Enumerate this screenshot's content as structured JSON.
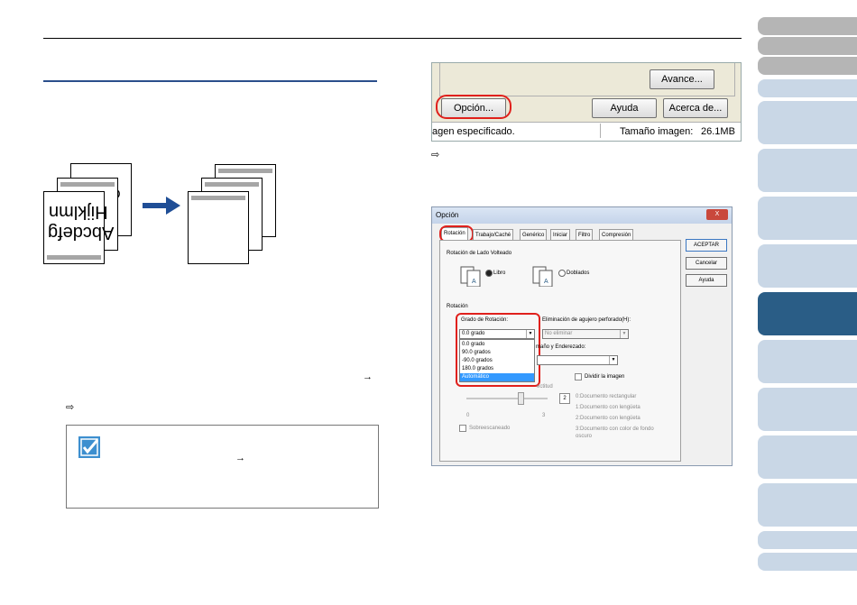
{
  "header": {
    "arrow_glyph": "⇨"
  },
  "left": {
    "see_also_arrow": "⇨",
    "ref_arrow": "→",
    "illustration": {
      "sample_text_line1": "Abcdefg",
      "sample_text_line2": "Hijklmn",
      "back_page_text": "O <"
    },
    "hint": {
      "ref_arrow": "→"
    }
  },
  "screenshot1": {
    "avance_label": "Avance...",
    "opcion_label": "Opción...",
    "ayuda_label": "Ayuda",
    "acerca_label": "Acerca de...",
    "status_left": "agen especificado.",
    "status_size_label": "Tamaño imagen:",
    "status_size_value": "26.1MB"
  },
  "dialog": {
    "title": "Opción",
    "close": "X",
    "tabs": [
      "Rotación",
      "Trabajo/Caché",
      "Genérico",
      "Iniciar",
      "Filtro",
      "Compresión"
    ],
    "buttons": {
      "accept": "ACEPTAR",
      "cancel": "Cancelar",
      "help": "Ayuda"
    },
    "flip_group": {
      "label": "Rotación de Lado Volteado",
      "book": "Libro",
      "folded": "Doblados"
    },
    "rotation_group": {
      "label": "Rotación",
      "degree_label": "Grado de Rotación:",
      "degree_value": "0.0 grado",
      "degree_options": [
        "0.0 grado",
        "90.0 grados",
        "-90.0 grados",
        "180.0 grados",
        "Automático"
      ],
      "punch_label": "Eliminación de agujero perforado(H):",
      "punch_value": "No eliminar",
      "size_deskew_label": "maño y Enderezado:",
      "split_label": "Dividir la imagen",
      "rectitud_label": "ectitud",
      "slider_min": "0",
      "slider_max": "3",
      "slider_value": "2",
      "doc_types": [
        "0:Documento rectangular",
        "1:Documento con lengüeta",
        "2:Documento con lengüeta",
        "3:Documento con color de fondo oscuro"
      ],
      "overscan_label": "Sobreescaneado"
    }
  },
  "colors": {
    "nav_active": "#2a5d86",
    "nav_light": "#c9d7e6",
    "nav_gray": "#b5b5b5",
    "highlight_red": "#e0201c",
    "rule_blue": "#2b4f8c",
    "arrow_blue": "#1f4e96"
  }
}
